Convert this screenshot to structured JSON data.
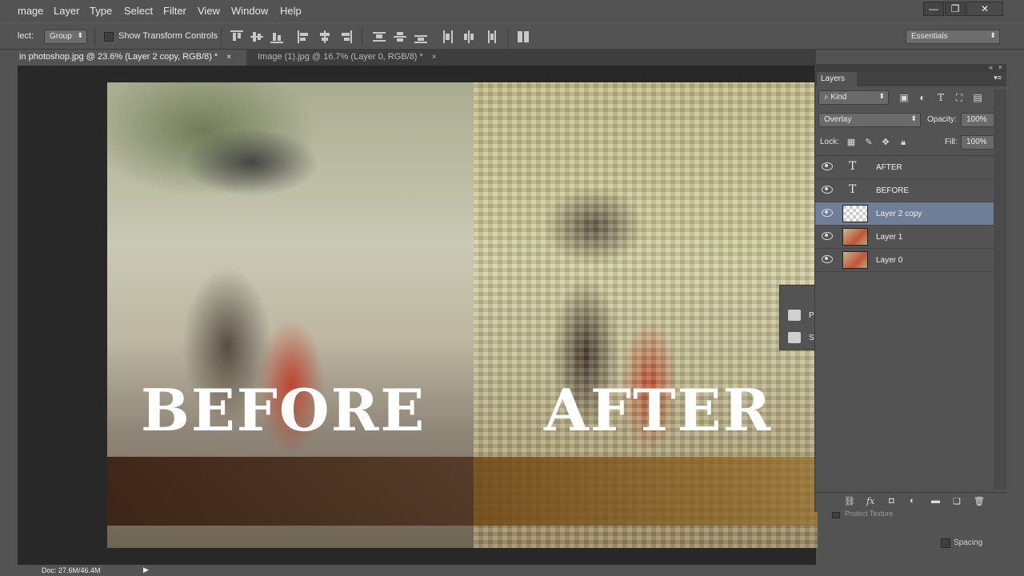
{
  "menu": {
    "items": [
      "mage",
      "Layer",
      "Type",
      "Select",
      "Filter",
      "View",
      "Window",
      "Help"
    ],
    "window_buttons": {
      "minimize": "—",
      "restore": "❐",
      "close": "✕"
    }
  },
  "options": {
    "select_label": "lect:",
    "select_value": "Group",
    "transform_label": "Show Transform Controls",
    "workspace_value": "Essentials"
  },
  "tabs": [
    {
      "label": "in photoshop.jpg @ 23.6% (Layer 2 copy, RGB/8) *",
      "close": "×"
    },
    {
      "label": "Image (1).jpg @ 16.7% (Layer 0, RGB/8) *",
      "close": "×"
    }
  ],
  "canvas": {
    "before_text": "BEFORE",
    "after_text": "AFTER"
  },
  "mini_panel": {
    "item1": "P",
    "item2": "S"
  },
  "layers_panel": {
    "title": "Layers",
    "kind_label": "Kind",
    "blend_mode": "Overlay",
    "opacity_label": "Opacity:",
    "opacity_value": "100%",
    "lock_label": "Lock:",
    "fill_label": "Fill:",
    "fill_value": "100%",
    "layers": [
      {
        "name": "AFTER",
        "kind": "text"
      },
      {
        "name": "BEFORE",
        "kind": "text"
      },
      {
        "name": "Layer 2 copy",
        "kind": "empty",
        "selected": true
      },
      {
        "name": "Layer 1",
        "kind": "image"
      },
      {
        "name": "Layer 0",
        "kind": "image"
      }
    ]
  },
  "below_panel": {
    "protect_texture": "Protect Texture",
    "spacing": "Spacing"
  },
  "status": {
    "doc": "Doc: 27.6M/46.4M"
  }
}
